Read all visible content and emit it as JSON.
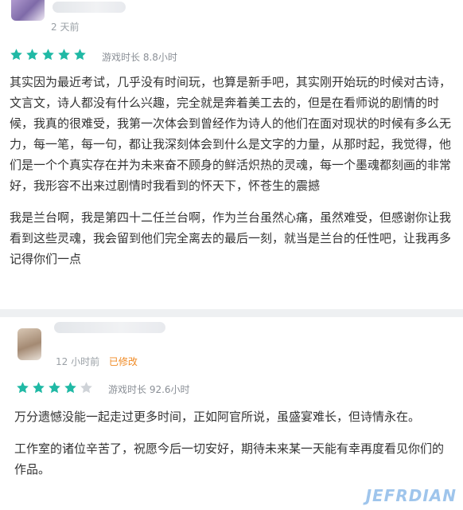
{
  "reviews": [
    {
      "time": "2 天前",
      "edited_label": "",
      "rating": 5,
      "playtime": "游戏时长 8.8小时",
      "paragraphs": [
        "其实因为最近考试，几乎没有时间玩，也算是新手吧，其实刚开始玩的时候对古诗，文言文，诗人都没有什么兴趣，完全就是奔着美工去的，但是在看师说的剧情的时候，我真的很难受，我第一次体会到曾经作为诗人的他们在面对现状的时候有多么无力，每一笔，每一句，都让我深刻体会到什么是文字的力量，从那时起，我觉得，他们是一个个真实存在并为未来奋不顾身的鲜活炽热的灵魂，每一个墨魂都刻画的非常好，我形容不出来过剧情时我看到的怀天下，怀苍生的震撼",
        "我是兰台啊，我是第四十二任兰台啊，作为兰台虽然心痛，虽然难受，但感谢你让我看到这些灵魂，我会留到他们完全离去的最后一刻，就当是兰台的任性吧，让我再多记得你们一点"
      ]
    },
    {
      "time": "12 小时前",
      "edited_label": "已修改",
      "rating": 4,
      "playtime": "游戏时长 92.6小时",
      "paragraphs": [
        "万分遗憾没能一起走过更多时间，正如阿官所说，虽盛宴难长，但诗情永在。",
        "工作室的诸位辛苦了，祝愿今后一切安好，期待未来某一天能有幸再度看见你们的作品。"
      ]
    }
  ],
  "colors": {
    "star_filled": "#20b9a5",
    "star_empty": "#cfd3d8",
    "edited": "#f08a24"
  },
  "watermark": "JEFRDIAN"
}
